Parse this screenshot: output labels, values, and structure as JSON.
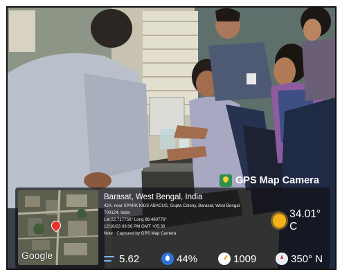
{
  "overlay": {
    "brand": "GPS Map Camera",
    "map_label": "Google",
    "city": "Barasat, West Bengal, India",
    "address_line1": "42A, near SPARK KIDS ABACUS, Gupta Colony, Barasat, West Bengal",
    "address_line2": "700124, India",
    "coords": "Lat 22.717756° Long 88.480776°",
    "datetime": "12/10/23 03:06 PM GMT +05:30",
    "note": "Note : Captured by GPS Map Camera",
    "temperature": "34.01° C",
    "wind": "5.62",
    "humidity": "44%",
    "pressure": "1009",
    "heading": "350° N"
  },
  "icons": [
    "location-logo-icon",
    "map-pin-icon",
    "sun-icon",
    "wind-icon",
    "humidity-icon",
    "pressure-gauge-icon",
    "compass-icon"
  ]
}
